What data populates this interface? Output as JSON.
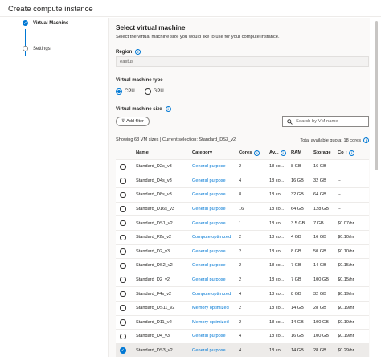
{
  "window": {
    "title": "Create compute instance"
  },
  "wizard": {
    "steps": [
      {
        "label": "Virtual Machine",
        "state": "active"
      },
      {
        "label": "Settings",
        "state": "inactive"
      }
    ]
  },
  "main": {
    "heading": "Select virtual machine",
    "description": "Select the virtual machine size you would like to use for your compute instance.",
    "region_label": "Region",
    "region_value": "eastus",
    "vm_type_label": "Virtual machine type",
    "vm_type_options": [
      {
        "label": "CPU",
        "selected": true
      },
      {
        "label": "GPU",
        "selected": false
      }
    ],
    "vm_size_label": "Virtual machine size",
    "add_filter_label": "Add filter",
    "search_placeholder": "Search by VM name",
    "summary": "Showing 63 VM sizes | Current selection: Standard_DS3_v2",
    "quota": "Total available quota: 18 cores"
  },
  "table": {
    "headers": {
      "name": "Name",
      "category": "Category",
      "cores": "Cores",
      "available": "Av...",
      "ram": "RAM",
      "storage": "Storage",
      "cost": "Co"
    },
    "rows": [
      {
        "selected": false,
        "name": "Standard_D2s_v3",
        "category": "General purpose",
        "cores": "2",
        "available": "18 co...",
        "ram": "8 GB",
        "storage": "16 GB",
        "cost": "--"
      },
      {
        "selected": false,
        "name": "Standard_D4s_v3",
        "category": "General purpose",
        "cores": "4",
        "available": "18 co...",
        "ram": "16 GB",
        "storage": "32 GB",
        "cost": "--"
      },
      {
        "selected": false,
        "name": "Standard_D8s_v3",
        "category": "General purpose",
        "cores": "8",
        "available": "18 co...",
        "ram": "32 GB",
        "storage": "64 GB",
        "cost": "--"
      },
      {
        "selected": false,
        "name": "Standard_D16s_v3",
        "category": "General purpose",
        "cores": "16",
        "available": "18 co...",
        "ram": "64 GB",
        "storage": "128 GB",
        "cost": "--"
      },
      {
        "selected": false,
        "name": "Standard_DS1_v2",
        "category": "General purpose",
        "cores": "1",
        "available": "18 co...",
        "ram": "3.5 GB",
        "storage": "7 GB",
        "cost": "$0.07/hr"
      },
      {
        "selected": false,
        "name": "Standard_F2s_v2",
        "category": "Compute optimized",
        "cores": "2",
        "available": "18 co...",
        "ram": "4 GB",
        "storage": "16 GB",
        "cost": "$0.10/hr"
      },
      {
        "selected": false,
        "name": "Standard_D2_v3",
        "category": "General purpose",
        "cores": "2",
        "available": "18 co...",
        "ram": "8 GB",
        "storage": "50 GB",
        "cost": "$0.10/hr"
      },
      {
        "selected": false,
        "name": "Standard_DS2_v2",
        "category": "General purpose",
        "cores": "2",
        "available": "18 co...",
        "ram": "7 GB",
        "storage": "14 GB",
        "cost": "$0.15/hr"
      },
      {
        "selected": false,
        "name": "Standard_D2_v2",
        "category": "General purpose",
        "cores": "2",
        "available": "18 co...",
        "ram": "7 GB",
        "storage": "100 GB",
        "cost": "$0.15/hr"
      },
      {
        "selected": false,
        "name": "Standard_F4s_v2",
        "category": "Compute optimized",
        "cores": "4",
        "available": "18 co...",
        "ram": "8 GB",
        "storage": "32 GB",
        "cost": "$0.19/hr"
      },
      {
        "selected": false,
        "name": "Standard_DS11_v2",
        "category": "Memory optimized",
        "cores": "2",
        "available": "18 co...",
        "ram": "14 GB",
        "storage": "28 GB",
        "cost": "$0.19/hr"
      },
      {
        "selected": false,
        "name": "Standard_D11_v2",
        "category": "Memory optimized",
        "cores": "2",
        "available": "18 co...",
        "ram": "14 GB",
        "storage": "100 GB",
        "cost": "$0.19/hr"
      },
      {
        "selected": false,
        "name": "Standard_D4_v3",
        "category": "General purpose",
        "cores": "4",
        "available": "18 co...",
        "ram": "16 GB",
        "storage": "100 GB",
        "cost": "$0.19/hr"
      },
      {
        "selected": true,
        "name": "Standard_DS3_v2",
        "category": "General purpose",
        "cores": "4",
        "available": "18 co...",
        "ram": "14 GB",
        "storage": "28 GB",
        "cost": "$0.29/hr"
      }
    ]
  },
  "colors": {
    "accent": "#0078d4",
    "panel_bg": "#faf9f8",
    "selected_row": "#edebe9",
    "border": "#edebe9"
  },
  "icons": {
    "info": "info-icon",
    "filter": "filter-icon",
    "search": "search-icon",
    "check": "checkmark-icon",
    "sort": "sort-icon"
  }
}
